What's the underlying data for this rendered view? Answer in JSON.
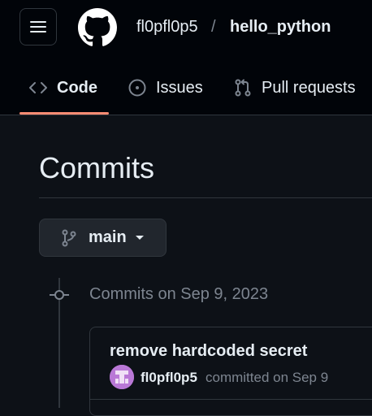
{
  "header": {
    "repo_owner": "fl0pfl0p5",
    "separator": "/",
    "repo_name": "hello_python"
  },
  "tabs": [
    {
      "label": "Code",
      "icon": "code-icon",
      "active": true
    },
    {
      "label": "Issues",
      "icon": "issue-icon",
      "active": false
    },
    {
      "label": "Pull requests",
      "icon": "pull-request-icon",
      "active": false
    }
  ],
  "page": {
    "title": "Commits"
  },
  "branch": {
    "label": "main",
    "icon": "branch-icon"
  },
  "commit_groups": [
    {
      "date_label": "Commits on Sep 9, 2023",
      "commits": [
        {
          "message": "remove hardcoded secret",
          "author": "fl0pfl0p5",
          "meta": "committed on Sep 9"
        }
      ]
    }
  ],
  "colors": {
    "background": "#0d1117",
    "header_bg": "#010409",
    "active_tab_underline": "#fd8c73",
    "muted_text": "#7d8590",
    "border": "#30363d"
  }
}
